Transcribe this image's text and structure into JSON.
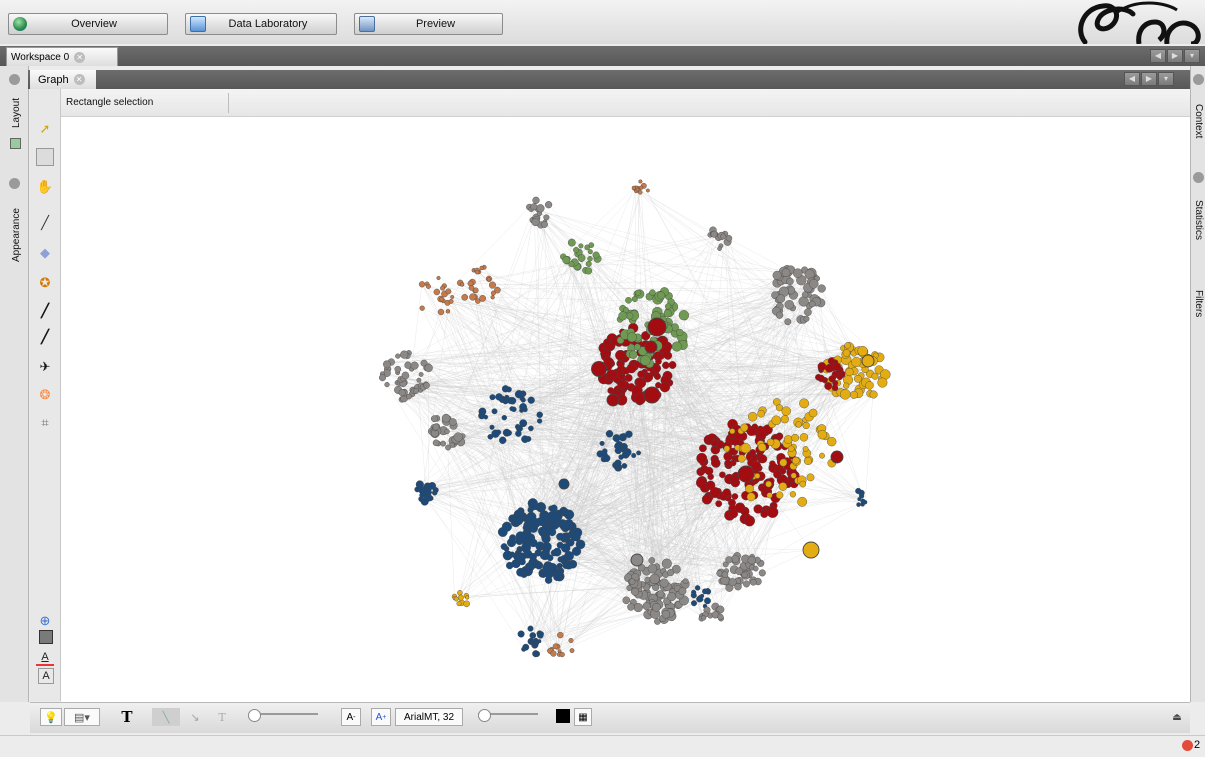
{
  "modes": {
    "overview_label": "Overview",
    "data_laboratory_label": "Data Laboratory",
    "preview_label": "Preview"
  },
  "workspace": {
    "tab_label": "Workspace 0"
  },
  "graph_window": {
    "tab_label": "Graph",
    "selection_mode": "Rectangle selection"
  },
  "left_panels": {
    "layout_label": "Layout",
    "appearance_label": "Appearance"
  },
  "right_panels": {
    "context_label": "Context",
    "statistics_label": "Statistics",
    "filters_label": "Filters"
  },
  "bottom_toolbar": {
    "text_icon_label": "T",
    "font_value": "ArialMT, 32",
    "font_size_up_label": "A",
    "font_size_down_label": "A"
  },
  "status": {
    "notification_count": "2"
  },
  "colors": {
    "red": "#a30d12",
    "green": "#6f9a53",
    "gold": "#e3ac12",
    "blue": "#1d4a78",
    "gray": "#8c8886",
    "orange": "#c47a4a",
    "edge": "#c8c8c8"
  },
  "icons": [
    "overview-globe-icon",
    "data-laboratory-icon",
    "preview-icon",
    "gephi-logo",
    "select-arrow-icon",
    "rectangle-select-icon",
    "drag-icon",
    "brush-icon",
    "diamond-icon",
    "painter-icon",
    "pencil-icon",
    "edge-pencil-icon",
    "path-plane-icon",
    "shortest-path-icon",
    "help-cursor-icon",
    "zoom-icon",
    "background-color-icon",
    "label-color-icon",
    "label-font-icon",
    "lightbulb-icon",
    "screenshot-icon",
    "bold-text-icon",
    "edge-straight-icon",
    "edge-color-icon",
    "edge-label-icon",
    "color-swatch-icon",
    "font-chooser-icon",
    "expand-icon",
    "error-circle-icon"
  ]
}
